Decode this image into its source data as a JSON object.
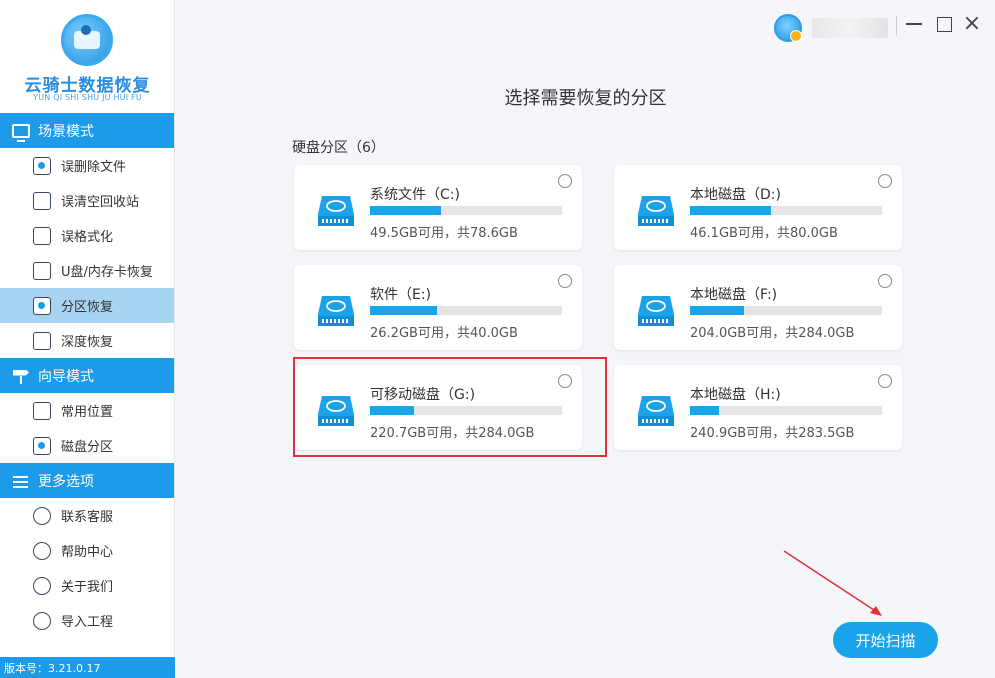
{
  "app": {
    "logo_title": "云骑士数据恢复",
    "logo_subtitle": "YUN QI SHI SHU JU HUI FU",
    "version": "版本号：3.21.0.17",
    "accent_color": "#1d9be8"
  },
  "sidebar": {
    "sections": [
      {
        "title": "场景模式",
        "icon": "monitor-icon",
        "items": [
          {
            "label": "误删除文件",
            "icon": "deleted-file-icon"
          },
          {
            "label": "误清空回收站",
            "icon": "recycle-bin-icon"
          },
          {
            "label": "误格式化",
            "icon": "format-icon"
          },
          {
            "label": "U盘/内存卡恢复",
            "icon": "usb-card-icon"
          },
          {
            "label": "分区恢复",
            "icon": "partition-icon",
            "active": true
          },
          {
            "label": "深度恢复",
            "icon": "deep-recovery-icon"
          }
        ]
      },
      {
        "title": "向导模式",
        "icon": "signpost-icon",
        "items": [
          {
            "label": "常用位置",
            "icon": "windows-icon"
          },
          {
            "label": "磁盘分区",
            "icon": "disk-partition-icon"
          }
        ]
      },
      {
        "title": "更多选项",
        "icon": "menu-icon",
        "items": [
          {
            "label": "联系客服",
            "icon": "phone-icon"
          },
          {
            "label": "帮助中心",
            "icon": "help-icon"
          },
          {
            "label": "关于我们",
            "icon": "info-icon"
          },
          {
            "label": "导入工程",
            "icon": "import-icon"
          }
        ]
      }
    ]
  },
  "titlebar": {
    "username": "",
    "avatar_icon": "avatar-icon"
  },
  "main": {
    "title": "选择需要恢复的分区",
    "group_label": "硬盘分区（6）",
    "partitions": [
      {
        "name": "系统文件（C:)",
        "space": "49.5GB可用，共78.6GB",
        "used_fraction": 0.37
      },
      {
        "name": "本地磁盘（D:)",
        "space": "46.1GB可用，共80.0GB",
        "used_fraction": 0.42
      },
      {
        "name": "软件（E:)",
        "space": "26.2GB可用，共40.0GB",
        "used_fraction": 0.35
      },
      {
        "name": "本地磁盘（F:)",
        "space": "204.0GB可用，共284.0GB",
        "used_fraction": 0.28
      },
      {
        "name": "可移动磁盘（G:)",
        "space": "220.7GB可用，共284.0GB",
        "used_fraction": 0.23
      },
      {
        "name": "本地磁盘（H:)",
        "space": "240.9GB可用，共283.5GB",
        "used_fraction": 0.15
      }
    ],
    "scan_button": "开始扫描",
    "highlight_color": "#e0323a"
  }
}
